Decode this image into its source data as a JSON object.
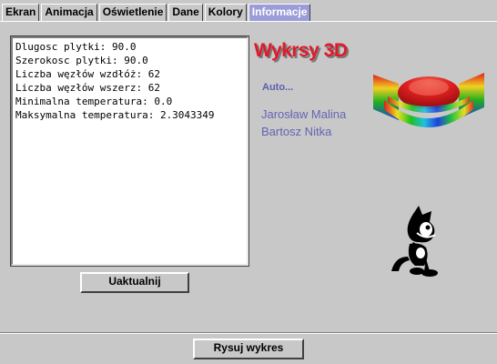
{
  "tabs": [
    {
      "label": "Ekran"
    },
    {
      "label": "Animacja"
    },
    {
      "label": "Oświetlenie"
    },
    {
      "label": "Dane"
    },
    {
      "label": "Kolory"
    },
    {
      "label": "Informacje",
      "active": true
    }
  ],
  "info": {
    "lines": [
      "Dlugosc plytki: 90.0",
      "Szerokosc plytki: 90.0",
      "Liczba węzłów wzdłóż: 62",
      "Liczba węzłów wszerz: 62",
      "Minimalna temperatura: 0.0",
      "Maksymalna temperatura: 2.3043349"
    ]
  },
  "buttons": {
    "update_label": "Uaktualnij",
    "draw_label": "Rysuj wykres"
  },
  "about": {
    "title": "Wykrsy 3D",
    "subtitle": "Auto...",
    "authors": [
      "Jarosław Malina",
      "Bartosz Nitka"
    ]
  },
  "colors": {
    "title": "#e01a2a",
    "active_tab": "#9c9cd8",
    "author_text": "#6464b4",
    "background": "#c8c8c8"
  },
  "icons": {
    "plot": "3d-surface-plot-icon",
    "mascot": "cartoon-cat-icon"
  }
}
